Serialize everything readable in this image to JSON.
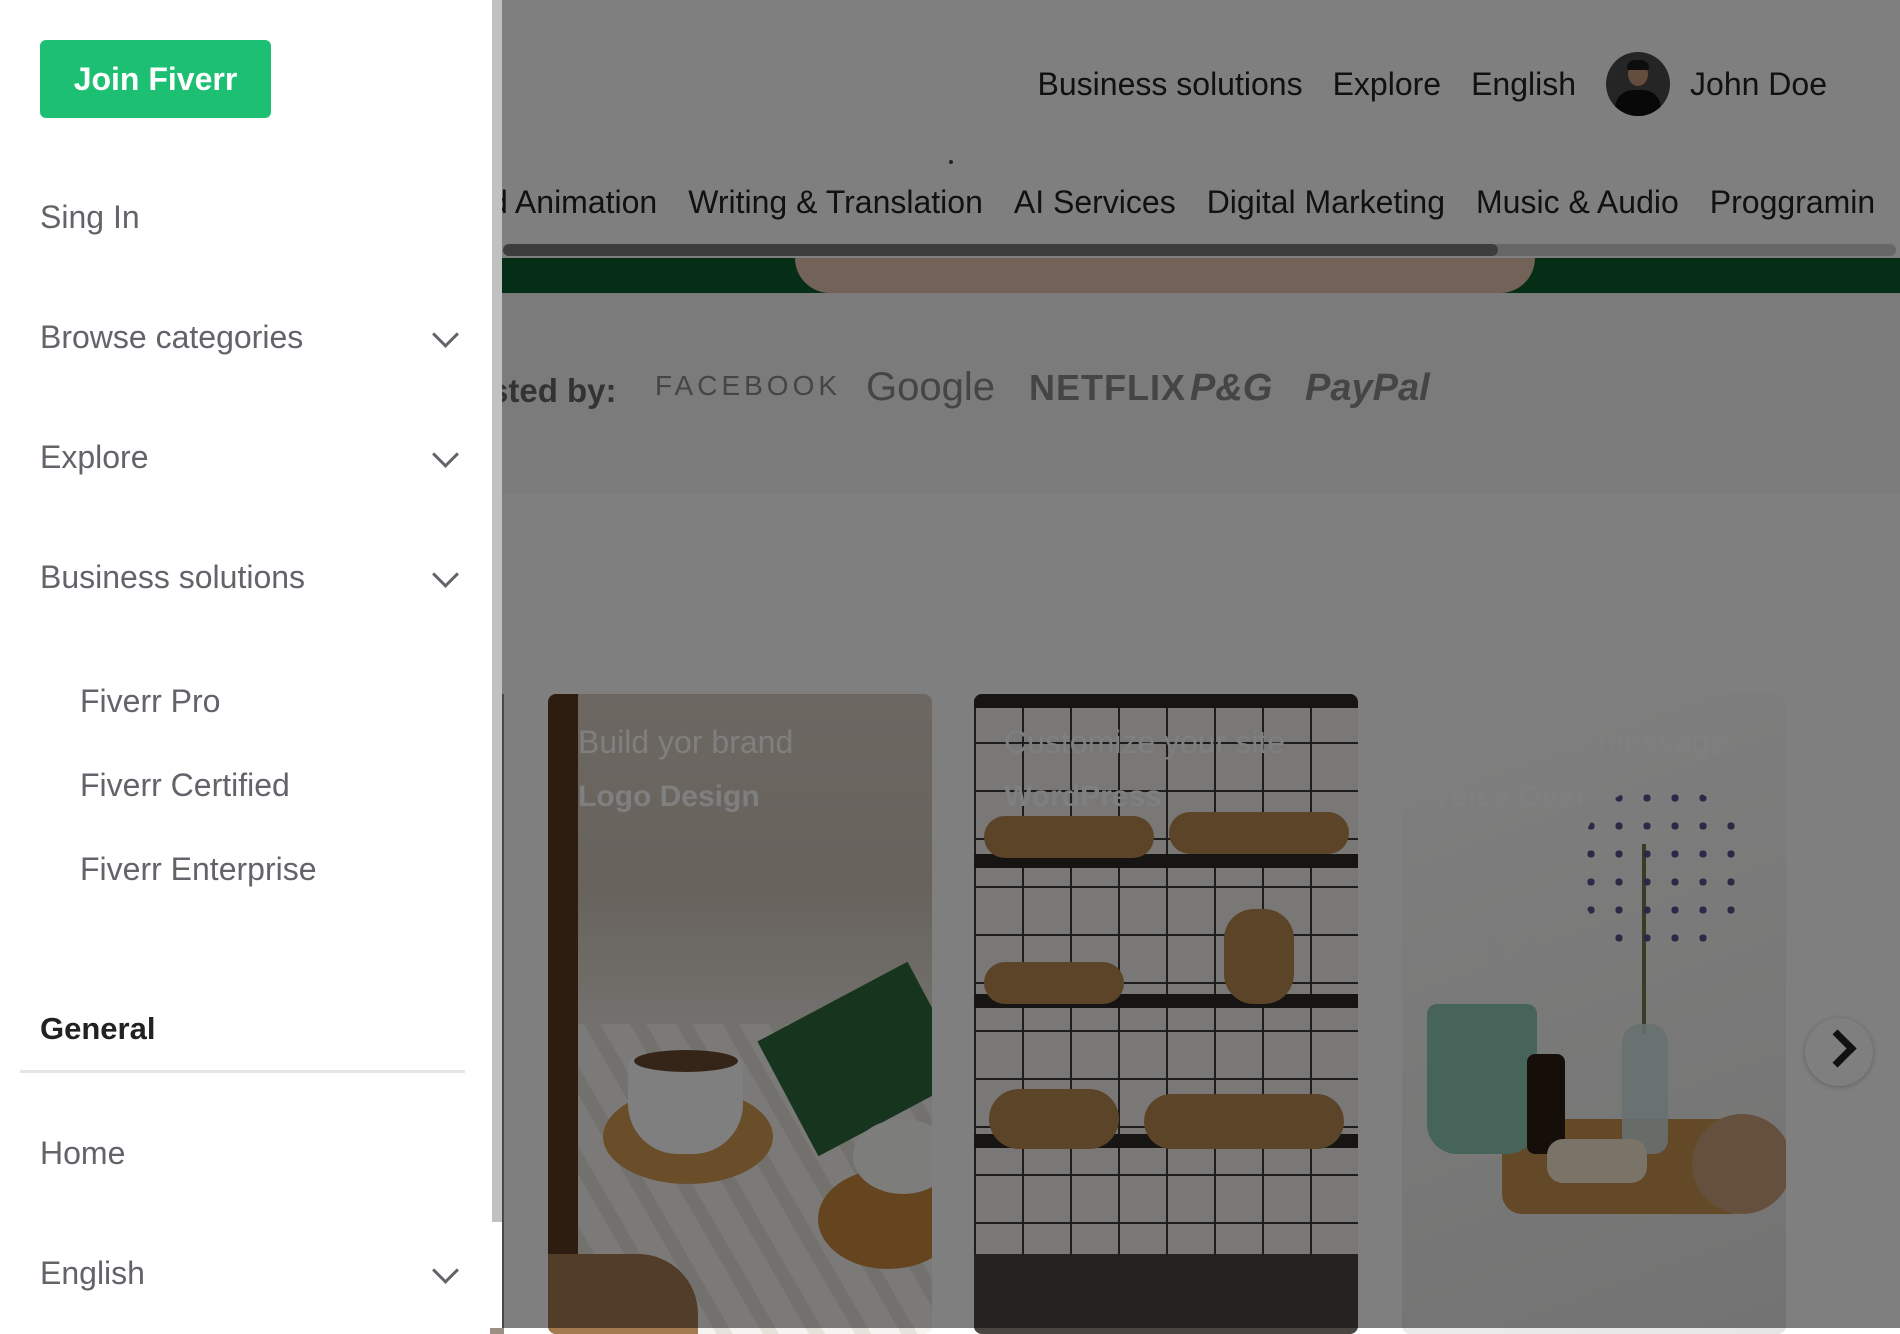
{
  "header": {
    "nav": [
      "Business solutions",
      "Explore",
      "English"
    ],
    "user_name": "John Doe"
  },
  "categories": [
    "d Animation",
    "Writing & Translation",
    "AI Services",
    "Digital Marketing",
    "Music & Audio",
    "Proggramin"
  ],
  "trusted": {
    "label": "sted by:",
    "logos": [
      "FACEBOOK",
      "Google",
      "NETFLIX",
      "P&G",
      "PayPal"
    ]
  },
  "cards": [
    {
      "subtitle": "Build yor brand",
      "title": "Logo Design"
    },
    {
      "subtitle": "Customize your site",
      "title": "WordPress"
    },
    {
      "subtitle": "Share your message",
      "title": "Voice Over"
    }
  ],
  "drawer": {
    "join_label": "Join Fiverr",
    "sign_in": "Sing In",
    "browse": "Browse categories",
    "explore": "Explore",
    "business": "Business solutions",
    "sub_items": [
      "Fiverr Pro",
      "Fiverr Certified",
      "Fiverr Enterprise"
    ],
    "general_title": "General",
    "home": "Home",
    "language": "English"
  },
  "colors": {
    "brand_green": "#1dbf73",
    "overlay": "rgba(0,0,0,0.5)",
    "drawer_text": "#62646a"
  },
  "icons": [
    "chevron-down-icon",
    "chevron-right-icon",
    "avatar"
  ]
}
